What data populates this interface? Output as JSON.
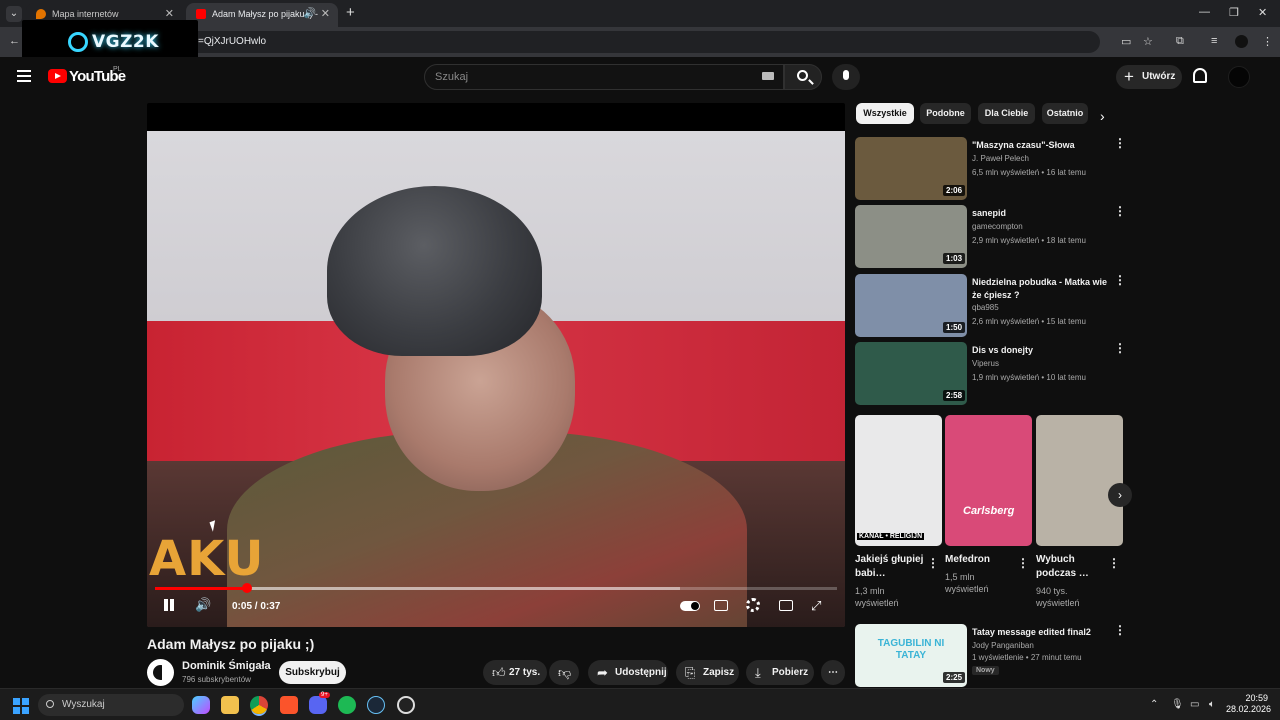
{
  "browser": {
    "tabs": [
      {
        "title": "Mapa internetów",
        "active": false
      },
      {
        "title": "Adam Małysz po pijaku ;) -",
        "active": true
      }
    ],
    "address": "=QjXJrUOHwlo",
    "watermark": "VGZ2K"
  },
  "header": {
    "brand": "YouTube",
    "region": "PL",
    "search_placeholder": "Szukaj",
    "create_label": "Utwórz"
  },
  "player": {
    "overlay_text": "AKU",
    "current_time": "0:05",
    "duration": "0:37",
    "time_label": "0:05 / 0:37",
    "progress_played": 0.135,
    "progress_buffered": 0.77
  },
  "video": {
    "title": "Adam Małysz po pijaku ;)",
    "channel": "Dominik Śmigała",
    "subscribers": "796 subskrybentów",
    "subscribe_label": "Subskrybuj",
    "likes": "27 tys.",
    "share_label": "Udostępnij",
    "save_label": "Zapisz",
    "download_label": "Pobierz"
  },
  "chips": [
    "Wszystkie",
    "Podobne",
    "Dla Ciebie",
    "Ostatnio"
  ],
  "recommendations": [
    {
      "title": "\"Maszyna czasu\"-Słowa",
      "channel": "J. Paweł Pelech",
      "meta": "6,5 mln wyświetleń • 16 lat temu",
      "duration": "2:06",
      "thumb_color": "#6b5a3e"
    },
    {
      "title": "sanepid",
      "channel": "gamecompton",
      "meta": "2,9 mln wyświetleń • 18 lat temu",
      "duration": "1:03",
      "thumb_color": "#8c8f86"
    },
    {
      "title": "Niedzielna pobudka - Matka wie że ćpiesz ?",
      "channel": "qba985",
      "meta": "2,6 mln wyświetleń • 15 lat temu",
      "duration": "1:50",
      "thumb_color": "#7f8fa8"
    },
    {
      "title": "Dis vs donejty",
      "channel": "Viperus",
      "meta": "1,9 mln wyświetleń • 10 lat temu",
      "duration": "2:58",
      "thumb_color": "#2f5a4a"
    }
  ],
  "shorts": [
    {
      "title": "Jakiejś głupiej babi…",
      "views": "1,3 mln wyświetleń",
      "overlay": "KANAŁ • RELIGIJN",
      "thumb_color": "#e9e9ea"
    },
    {
      "title": "Mefedron",
      "views": "1,5 mln wyświetleń",
      "overlay": "Carlsberg",
      "thumb_color": "#d94a78"
    },
    {
      "title": "Wybuch podczas …",
      "views": "940 tys. wyświetleń",
      "overlay": "",
      "thumb_color": "#b9b2a6"
    }
  ],
  "last_rec": {
    "title": "Tatay message edited final2",
    "channel": "Jody Panganiban",
    "meta": "1 wyświetlenie • 27 minut temu",
    "badge": "Nowy",
    "duration": "2:25",
    "thumb_text": "TAGUBILIN NI TATAY"
  },
  "taskbar": {
    "search_label": "Wyszukaj",
    "time": "20:59",
    "date": "28.02.2026",
    "discord_badge": "9+"
  }
}
